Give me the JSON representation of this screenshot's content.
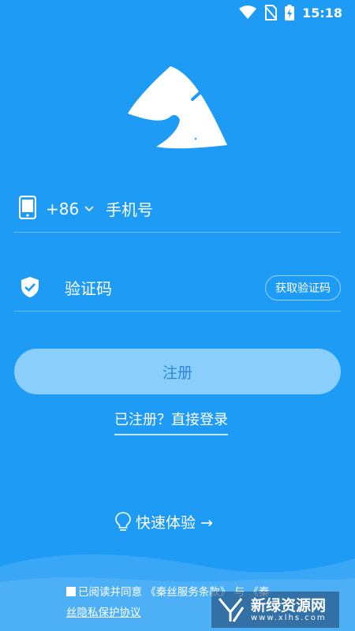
{
  "status_bar": {
    "time": "15:18",
    "icons": [
      "wifi-icon",
      "no-sim-icon",
      "battery-charging-icon"
    ]
  },
  "logo": {
    "icon": "mountain-camel-logo"
  },
  "phone": {
    "icon": "phone-icon",
    "country_code": "+86",
    "placeholder": "手机号",
    "value": ""
  },
  "code": {
    "icon": "shield-check-icon",
    "placeholder": "验证码",
    "value": "",
    "get_code_label": "获取验证码"
  },
  "register": {
    "label": "注册"
  },
  "login_link": "已注册？直接登录",
  "quick_experience": {
    "icon": "lightbulb-icon",
    "label": "快速体验 →"
  },
  "agreement": {
    "prefix": "已阅读并同意",
    "tos": "《秦丝服务条款》",
    "and": "与",
    "privacy_start": "《秦",
    "privacy_rest": "丝隐私保护协议",
    "checked": false
  },
  "watermark": {
    "title": "新绿资源网",
    "url": "www.xlhs.com"
  },
  "colors": {
    "background": "#1E9BF5",
    "button": "#8ACFFB",
    "button_text": "#2E86D6"
  }
}
